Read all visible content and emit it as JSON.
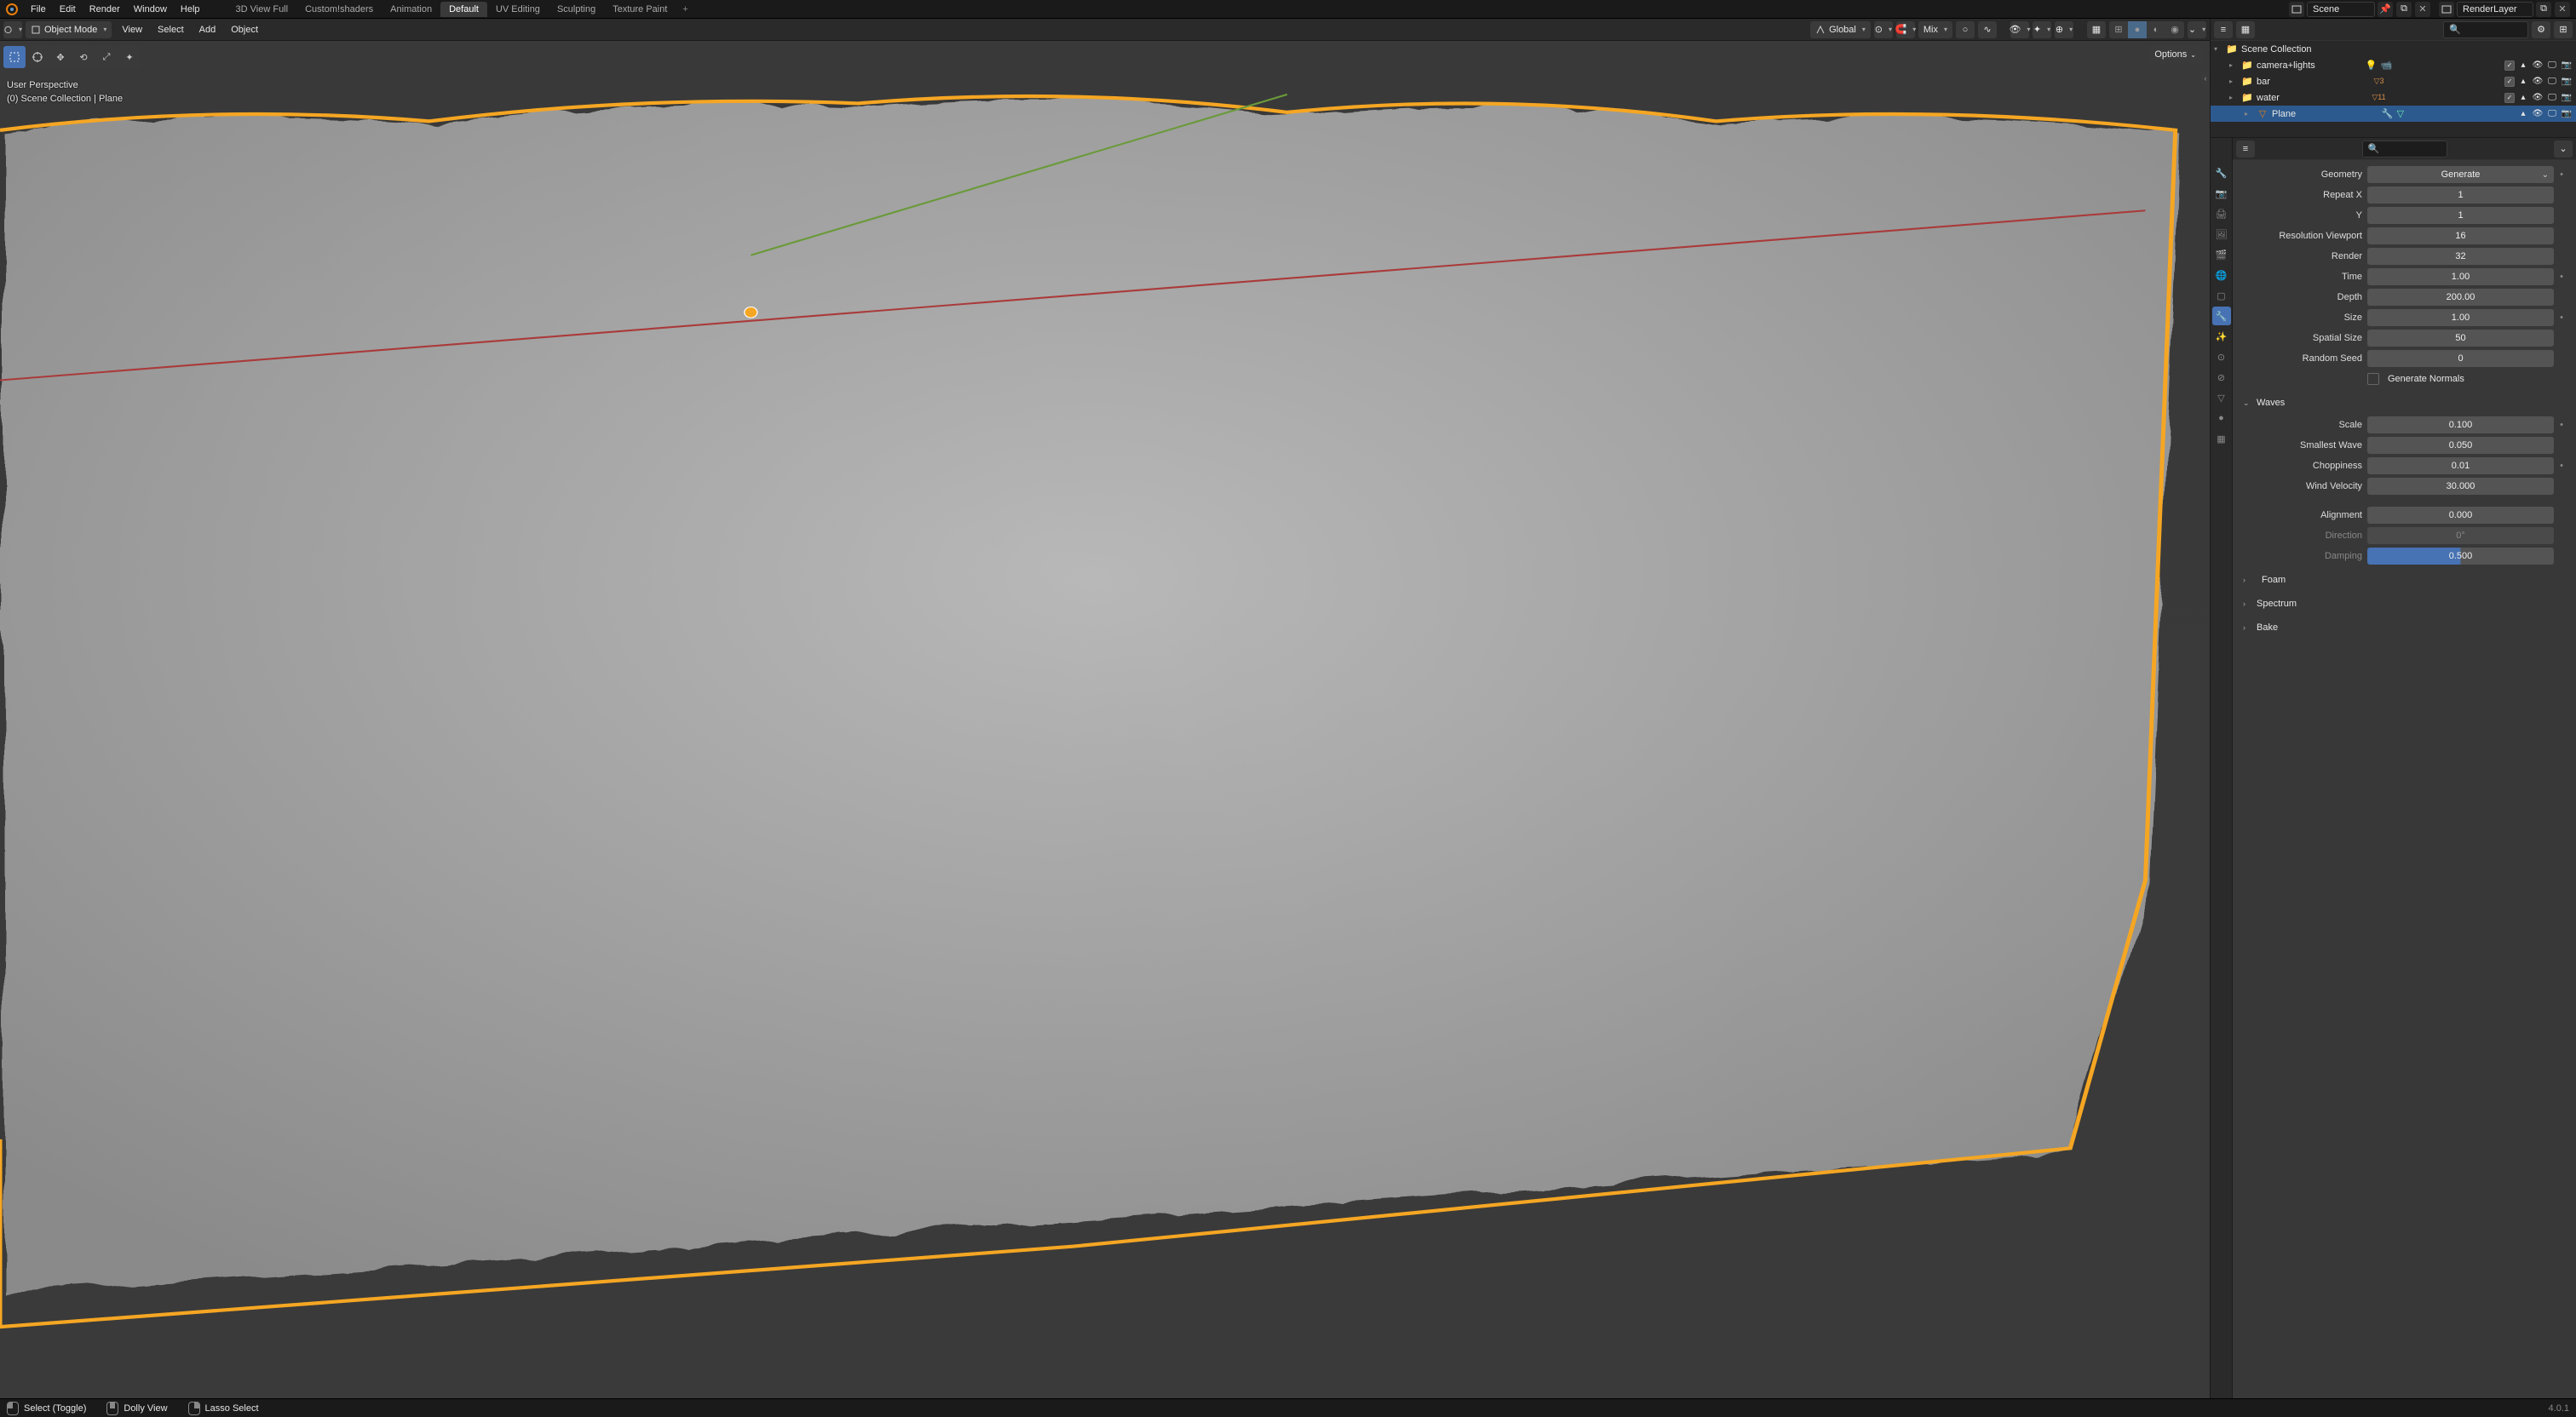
{
  "menu": {
    "items": [
      "File",
      "Edit",
      "Render",
      "Window",
      "Help"
    ],
    "workspaces": [
      "3D View Full",
      "Custom!shaders",
      "Animation",
      "Default",
      "UV Editing",
      "Sculpting",
      "Texture Paint"
    ],
    "active_workspace": 3,
    "scene_label": "Scene",
    "layer_label": "RenderLayer"
  },
  "viewport": {
    "mode": "Object Mode",
    "menus": [
      "View",
      "Select",
      "Add",
      "Object"
    ],
    "orientation": "Global",
    "snap": "Mix",
    "overlay_line1": "User Perspective",
    "overlay_line2": "(0) Scene Collection | Plane",
    "options_label": "Options"
  },
  "outliner": {
    "root": "Scene Collection",
    "items": [
      {
        "name": "camera+lights",
        "type": "collection",
        "count": ""
      },
      {
        "name": "bar",
        "type": "collection",
        "count": "3"
      },
      {
        "name": "water",
        "type": "collection",
        "count": "11"
      },
      {
        "name": "Plane",
        "type": "object",
        "selected": true
      }
    ]
  },
  "properties": {
    "geometry": {
      "label": "Geometry",
      "mode": "Generate",
      "repeat_x_label": "Repeat X",
      "repeat_x": "1",
      "y_label": "Y",
      "y": "1",
      "res_viewport_label": "Resolution Viewport",
      "res_viewport": "16",
      "render_label": "Render",
      "render": "32",
      "time_label": "Time",
      "time": "1.00",
      "depth_label": "Depth",
      "depth": "200.00",
      "size_label": "Size",
      "size": "1.00",
      "spatial_label": "Spatial Size",
      "spatial": "50",
      "seed_label": "Random Seed",
      "seed": "0",
      "gen_normals": "Generate Normals"
    },
    "waves": {
      "header": "Waves",
      "scale_label": "Scale",
      "scale": "0.100",
      "smallest_label": "Smallest Wave",
      "smallest": "0.050",
      "chop_label": "Choppiness",
      "chop": "0.01",
      "wind_label": "Wind Velocity",
      "wind": "30.000",
      "align_label": "Alignment",
      "align": "0.000",
      "dir_label": "Direction",
      "dir": "0°",
      "damp_label": "Damping",
      "damp": "0.500"
    },
    "sections": [
      "Foam",
      "Spectrum",
      "Bake"
    ]
  },
  "status": {
    "a": "Select (Toggle)",
    "b": "Dolly View",
    "c": "Lasso Select",
    "version": "4.0.1"
  }
}
